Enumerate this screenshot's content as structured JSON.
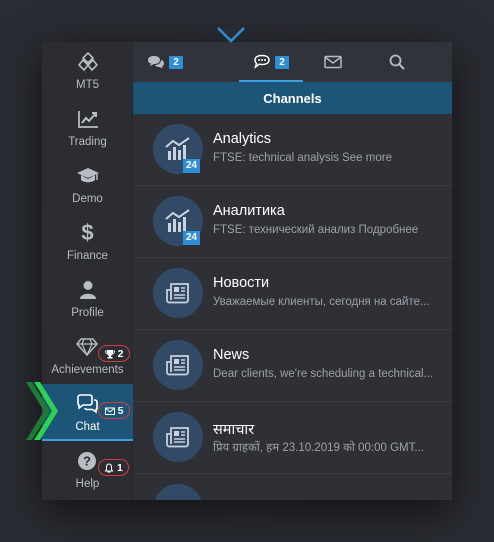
{
  "sidebar": {
    "items": [
      {
        "label": "MT5",
        "icon": "mt5-logo-icon"
      },
      {
        "label": "Trading",
        "icon": "trading-chart-icon"
      },
      {
        "label": "Demo",
        "icon": "graduation-cap-icon"
      },
      {
        "label": "Finance",
        "icon": "dollar-icon"
      },
      {
        "label": "Profile",
        "icon": "user-icon"
      },
      {
        "label": "Achievements",
        "icon": "diamond-icon",
        "badge": "2",
        "badge_icon": "trophy-icon"
      },
      {
        "label": "Chat",
        "icon": "chat-icon",
        "badge": "5",
        "badge_icon": "envelope-icon",
        "active": true
      },
      {
        "label": "Help",
        "icon": "help-icon",
        "badge": "1",
        "badge_icon": "bell-icon"
      }
    ]
  },
  "tabs": [
    {
      "icon": "chats-icon",
      "badge": "2"
    },
    {
      "icon": "channels-icon",
      "badge": "2",
      "active": true
    },
    {
      "icon": "mail-icon"
    },
    {
      "icon": "search-icon"
    },
    {
      "icon": "plus-icon"
    }
  ],
  "channels_title": "Channels",
  "channels": [
    {
      "title": "Analytics",
      "subtitle": "FTSE: technical analysis See more",
      "icon": "analytics-icon",
      "badge": "24"
    },
    {
      "title": "Аналитика",
      "subtitle": "FTSE: технический анализ Подробнее",
      "icon": "analytics-icon",
      "badge": "24"
    },
    {
      "title": "Новости",
      "subtitle": "Уважаемые клиенты, сегодня на сайте...",
      "icon": "newspaper-icon"
    },
    {
      "title": "News",
      "subtitle": "Dear clients, we're scheduling a technical...",
      "icon": "newspaper-icon"
    },
    {
      "title": "समाचार",
      "subtitle": "प्रिय ग्राहकों, हम 23.10.2019 को 00:00 GMT...",
      "icon": "newspaper-icon"
    },
    {
      "title": "",
      "subtitle": "",
      "icon": "newspaper-icon"
    }
  ],
  "colors": {
    "accent": "#1d5578",
    "highlight": "#3fa0e0",
    "badge_blue": "#2e8fd6",
    "badge_red": "#d63a3a",
    "arrow_green": "#2fd152"
  }
}
